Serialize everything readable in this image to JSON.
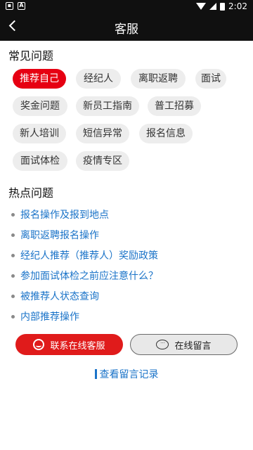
{
  "status_bar": {
    "time": "2:02"
  },
  "header": {
    "title": "客服"
  },
  "common": {
    "title": "常见问题",
    "tags": [
      "推荐自己",
      "经纪人",
      "离职返聘",
      "面试",
      "奖金问题",
      "新员工指南",
      "普工招募",
      "新人培训",
      "短信异常",
      "报名信息",
      "面试体检",
      "疫情专区"
    ]
  },
  "hot": {
    "title": "热点问题",
    "items": [
      "报名操作及报到地点",
      "离职返聘报名操作",
      "经纪人推荐（推荐人）奖励政策",
      "参加面试体检之前应注意什么？",
      "被推荐人状态查询",
      "内部推荐操作"
    ]
  },
  "buttons": {
    "online_service": "联系在线客服",
    "leave_message": "在线留言"
  },
  "record_link": "查看留言记录",
  "colors": {
    "accent_red": "#e60012",
    "link_blue": "#1a73c8"
  }
}
